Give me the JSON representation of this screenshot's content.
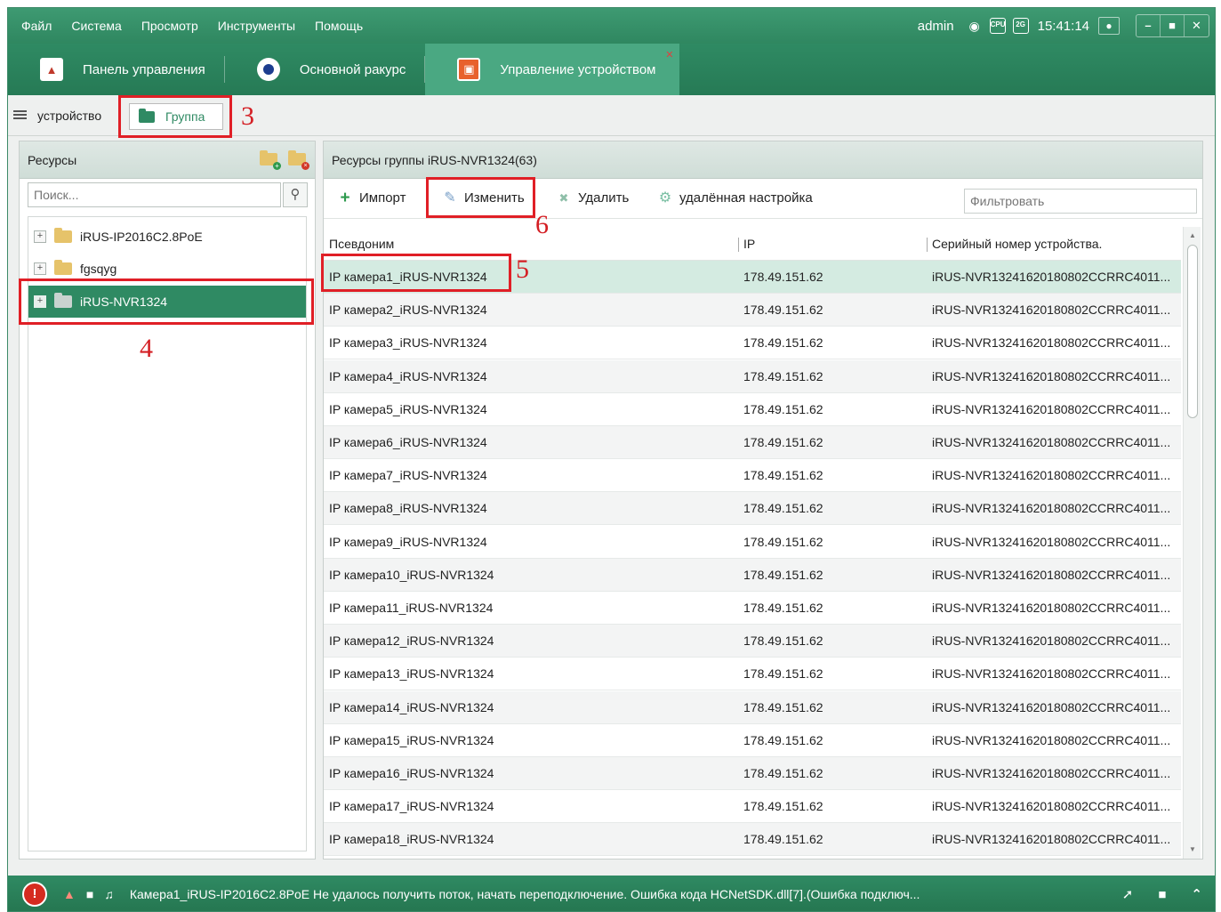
{
  "menubar": {
    "items": [
      "Файл",
      "Система",
      "Просмотр",
      "Инструменты",
      "Помощь"
    ],
    "user": "admin",
    "cpu_label": "CPU",
    "network_label": "2G",
    "clock": "15:41:14"
  },
  "module_tabs": [
    {
      "label": "Панель управления",
      "icon": "home-icon"
    },
    {
      "label": "Основной ракурс",
      "icon": "camera-view-icon"
    },
    {
      "label": "Управление устройством",
      "icon": "device-management-icon",
      "active": true
    }
  ],
  "subtabs": {
    "device": "устройство",
    "group": "Группа"
  },
  "left_panel": {
    "title": "Ресурсы",
    "search_placeholder": "Поиск...",
    "tree": [
      {
        "label": "iRUS-IP2016C2.8PoE"
      },
      {
        "label": "fgsqyg"
      },
      {
        "label": "iRUS-NVR1324",
        "selected": true
      }
    ]
  },
  "right_panel": {
    "title": "Ресурсы группы iRUS-NVR1324(63)",
    "toolbar": {
      "import": "Импорт",
      "edit": "Изменить",
      "delete": "Удалить",
      "remote": "удалённая настройка",
      "filter_placeholder": "Фильтровать"
    },
    "columns": [
      "Псевдоним",
      "IP",
      "Серийный номер устройства."
    ],
    "rows": [
      [
        "IP камера1_iRUS-NVR1324",
        "178.49.151.62",
        "iRUS-NVR13241620180802CCRRC4011..."
      ],
      [
        "IP камера2_iRUS-NVR1324",
        "178.49.151.62",
        "iRUS-NVR13241620180802CCRRC4011..."
      ],
      [
        "IP камера3_iRUS-NVR1324",
        "178.49.151.62",
        "iRUS-NVR13241620180802CCRRC4011..."
      ],
      [
        "IP камера4_iRUS-NVR1324",
        "178.49.151.62",
        "iRUS-NVR13241620180802CCRRC4011..."
      ],
      [
        "IP камера5_iRUS-NVR1324",
        "178.49.151.62",
        "iRUS-NVR13241620180802CCRRC4011..."
      ],
      [
        "IP камера6_iRUS-NVR1324",
        "178.49.151.62",
        "iRUS-NVR13241620180802CCRRC4011..."
      ],
      [
        "IP камера7_iRUS-NVR1324",
        "178.49.151.62",
        "iRUS-NVR13241620180802CCRRC4011..."
      ],
      [
        "IP камера8_iRUS-NVR1324",
        "178.49.151.62",
        "iRUS-NVR13241620180802CCRRC4011..."
      ],
      [
        "IP камера9_iRUS-NVR1324",
        "178.49.151.62",
        "iRUS-NVR13241620180802CCRRC4011..."
      ],
      [
        "IP камера10_iRUS-NVR1324",
        "178.49.151.62",
        "iRUS-NVR13241620180802CCRRC4011..."
      ],
      [
        "IP камера11_iRUS-NVR1324",
        "178.49.151.62",
        "iRUS-NVR13241620180802CCRRC4011..."
      ],
      [
        "IP камера12_iRUS-NVR1324",
        "178.49.151.62",
        "iRUS-NVR13241620180802CCRRC4011..."
      ],
      [
        "IP камера13_iRUS-NVR1324",
        "178.49.151.62",
        "iRUS-NVR13241620180802CCRRC4011..."
      ],
      [
        "IP камера14_iRUS-NVR1324",
        "178.49.151.62",
        "iRUS-NVR13241620180802CCRRC4011..."
      ],
      [
        "IP камера15_iRUS-NVR1324",
        "178.49.151.62",
        "iRUS-NVR13241620180802CCRRC4011..."
      ],
      [
        "IP камера16_iRUS-NVR1324",
        "178.49.151.62",
        "iRUS-NVR13241620180802CCRRC4011..."
      ],
      [
        "IP камера17_iRUS-NVR1324",
        "178.49.151.62",
        "iRUS-NVR13241620180802CCRRC4011..."
      ],
      [
        "IP камера18_iRUS-NVR1324",
        "178.49.151.62",
        "iRUS-NVR13241620180802CCRRC4011..."
      ]
    ]
  },
  "statusbar": {
    "message": "Камера1_iRUS-IP2016C2.8PoE Не удалось получить поток, начать переподключение. Ошибка кода HCNetSDK.dll[7].(Ошибка подключ..."
  },
  "annotations": [
    "3",
    "4",
    "5",
    "6"
  ],
  "colors": {
    "accent": "#2f8a63",
    "annotation": "#e01f26"
  }
}
